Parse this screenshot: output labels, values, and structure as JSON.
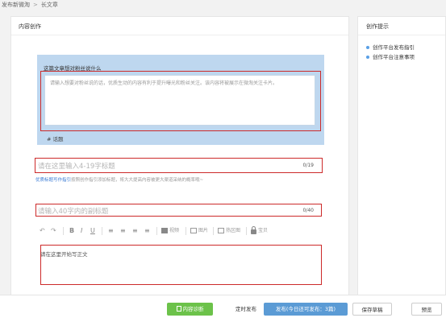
{
  "breadcrumb": {
    "root": "发布新微淘",
    "separator": ">",
    "current": "长文章"
  },
  "main": {
    "title": "内容创作",
    "topic": {
      "question": "这篇文章想对粉丝说什么",
      "intro_placeholder": "请输入想要对粉丝说的话，优质生动的内容有利于提升曝光和粉丝关注。该内容将被展示在微淘关注卡片。",
      "hashtag": "# 话题"
    },
    "title_field": {
      "placeholder": "请在这里输入4-19字标题",
      "counter": "0/19"
    },
    "tip": {
      "link": "优质标题写作指引",
      "text": "按照创作指引添加标题，将大大提高内容被更大渠道采纳的概率哦~"
    },
    "subtitle_field": {
      "placeholder": "请输入40字内的副标题",
      "counter": "0/40"
    },
    "toolbar": {
      "undo": "↶",
      "redo": "↷",
      "bold": "B",
      "italic": "I",
      "underline": "U",
      "align_left": "≡",
      "align_center": "≡",
      "align_right": "≡",
      "video": "视频",
      "image": "图片",
      "hotspot": "热区图",
      "treasure": "宝贝"
    },
    "body_placeholder": "请在这里开始写正文"
  },
  "side": {
    "title": "创作提示",
    "links": [
      "创作平台发布指引",
      "创作平台注意事项"
    ]
  },
  "footer": {
    "diagnose": "内容诊断",
    "timed_publish": "定时发布",
    "publish": "发布(今日还可发布：3篇)",
    "save_draft": "保存草稿",
    "preview": "预览"
  },
  "colors": {
    "highlight": "#cc2a2a",
    "topic_bg": "#bed7ef",
    "publish": "#5b9bd5",
    "diagnose": "#6cc24a",
    "link": "#3a7bd5"
  }
}
